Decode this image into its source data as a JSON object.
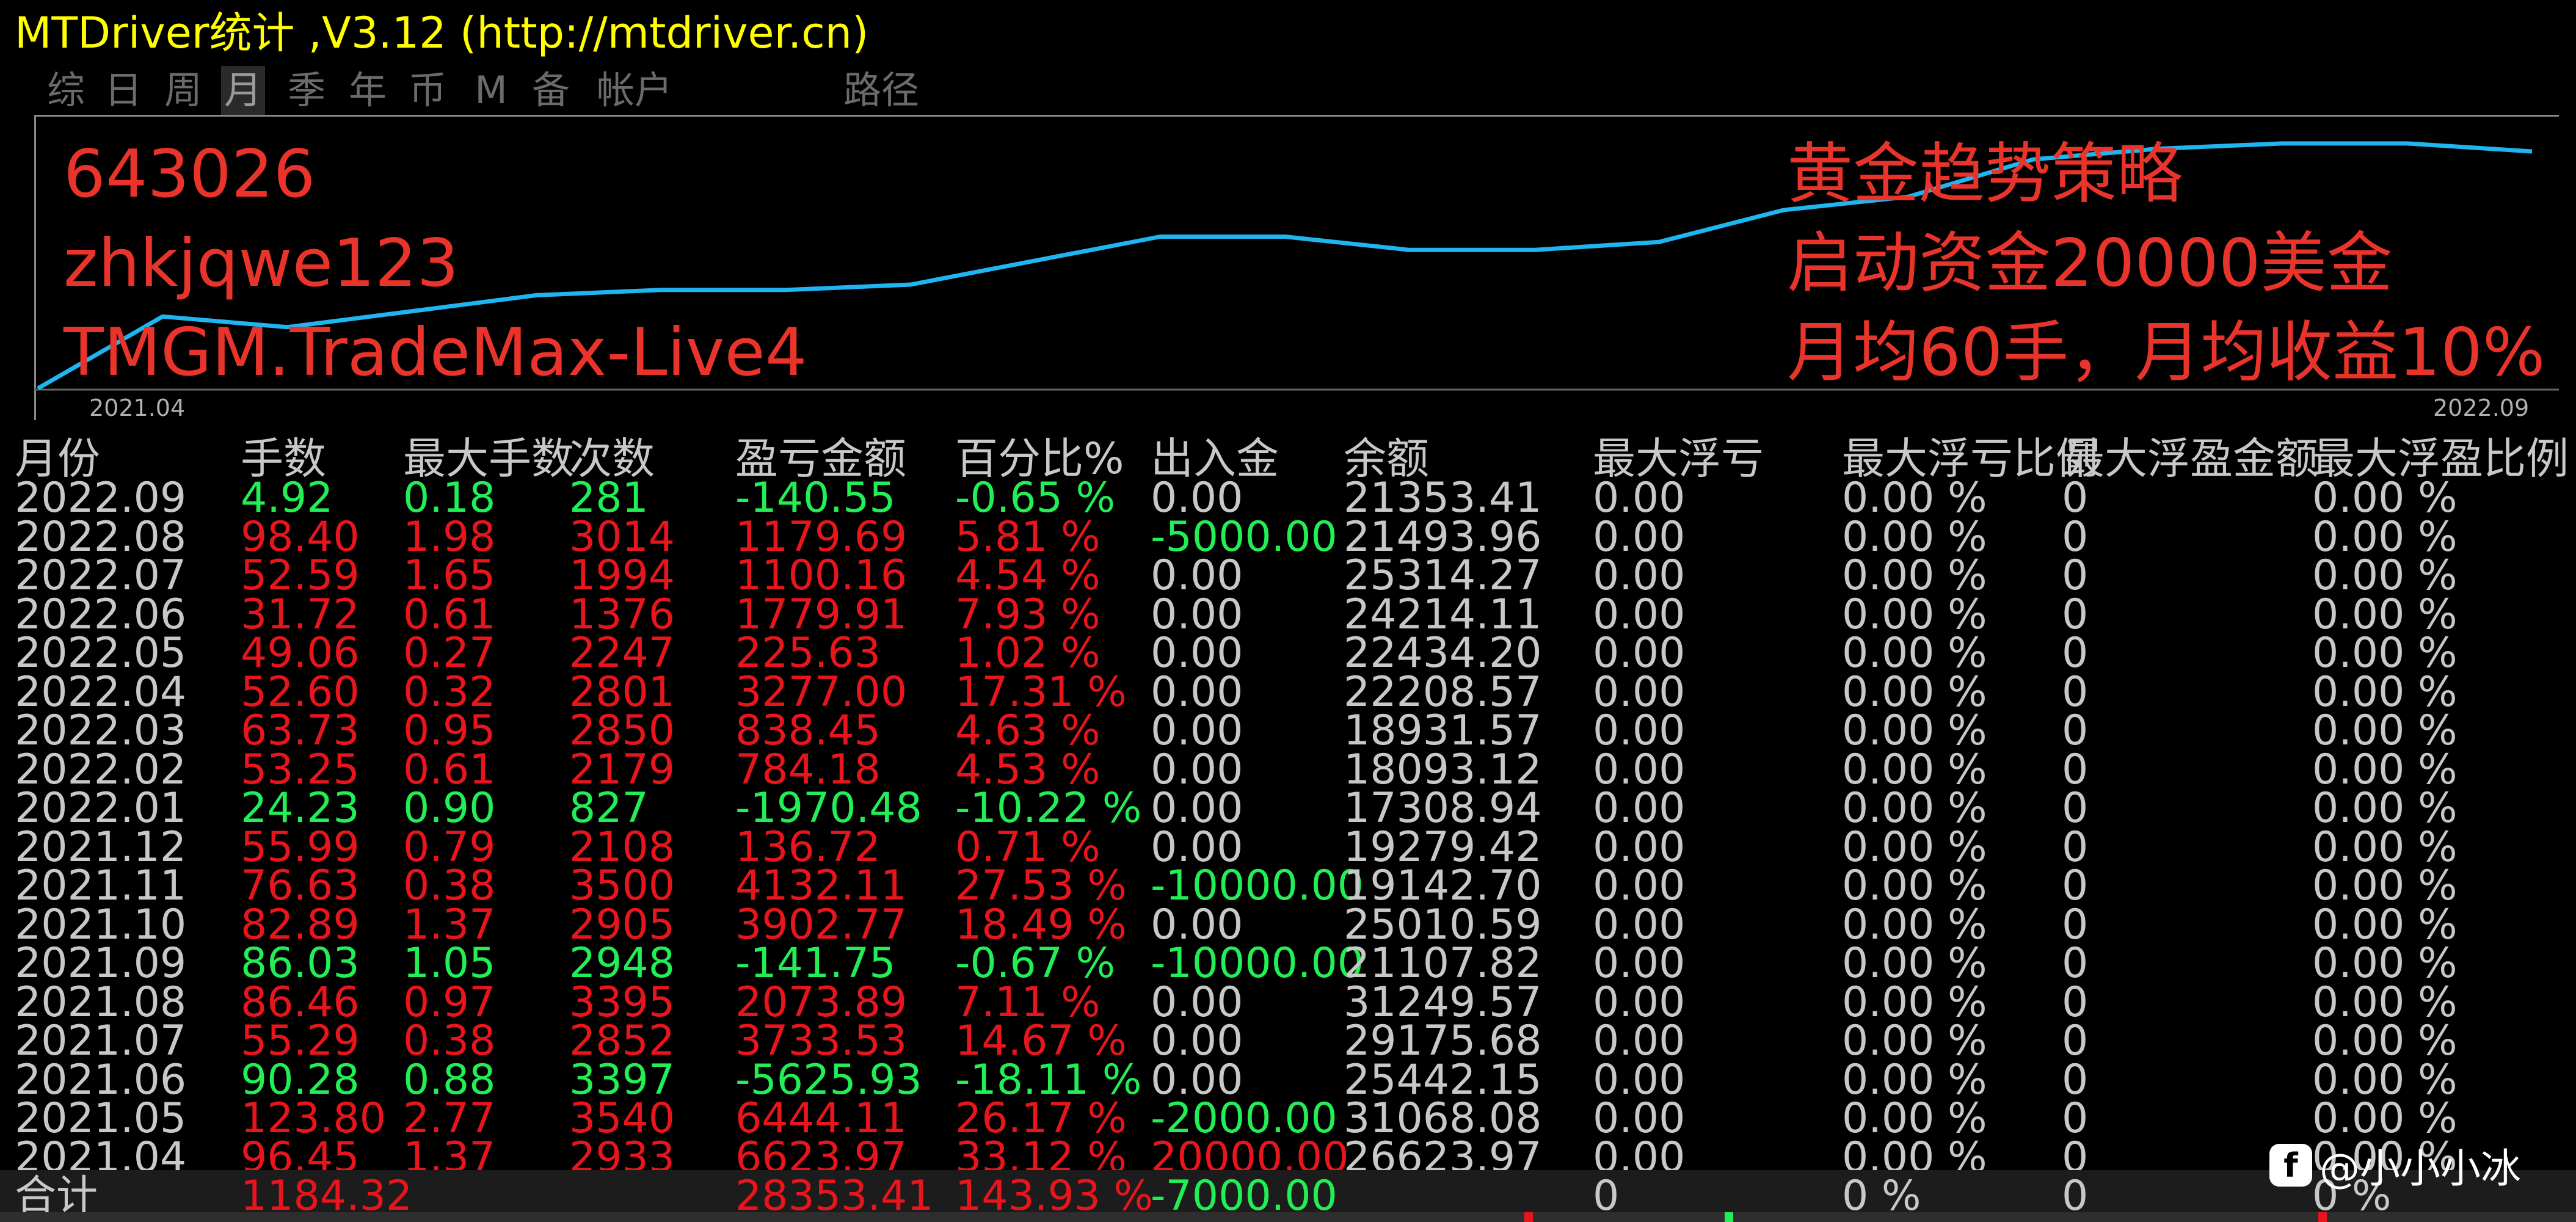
{
  "window": {
    "title": "MTDriver统计 ,V3.12 (http://mtdriver.cn)"
  },
  "tabs": [
    {
      "label": "综",
      "active": false
    },
    {
      "label": "日",
      "active": false
    },
    {
      "label": "周",
      "active": false
    },
    {
      "label": "月",
      "active": true
    },
    {
      "label": "季",
      "active": false
    },
    {
      "label": "年",
      "active": false
    },
    {
      "label": "币",
      "active": false
    },
    {
      "label": "M",
      "active": false
    },
    {
      "label": "备",
      "active": false
    },
    {
      "label": "帐户",
      "active": false
    },
    {
      "label": "路径",
      "active": false
    }
  ],
  "overlay": {
    "left_lines": [
      "643026",
      "zhkjqwe123",
      "TMGM.TradeMax-Live4"
    ],
    "right_lines": [
      "黄金趋势策略",
      "启动资金20000美金",
      "月均60手，月均收益10%"
    ]
  },
  "chart_data": {
    "type": "line",
    "x_start_label": "2021.04",
    "x_end_label": "2022.09",
    "series_color": "#1fb5f0",
    "points": [
      0.0,
      0.27,
      0.23,
      0.29,
      0.35,
      0.37,
      0.37,
      0.39,
      0.48,
      0.57,
      0.57,
      0.52,
      0.52,
      0.55,
      0.67,
      0.72,
      0.86,
      0.9,
      0.92,
      0.92,
      0.89
    ]
  },
  "table": {
    "headers": [
      "月份",
      "手数",
      "最大手数",
      "次数",
      "盈亏金额",
      "百分比%",
      "出入金",
      "余额",
      "最大浮亏",
      "最大浮亏比例",
      "最大浮盈金额",
      "最大浮盈比例"
    ],
    "rows": [
      {
        "month": "2022.09",
        "lots": "4.92",
        "max_lots": "0.18",
        "count": "281",
        "pnl": "-140.55",
        "pct": "-0.65 %",
        "deposit": "0.00",
        "balance": "21353.41",
        "max_float_loss": "0.00",
        "max_float_loss_pct": "0.00 %",
        "max_float_profit": "0",
        "max_float_profit_pct": "0.00 %",
        "color": "green",
        "deposit_color": "gray"
      },
      {
        "month": "2022.08",
        "lots": "98.40",
        "max_lots": "1.98",
        "count": "3014",
        "pnl": "1179.69",
        "pct": "5.81 %",
        "deposit": "-5000.00",
        "balance": "21493.96",
        "max_float_loss": "0.00",
        "max_float_loss_pct": "0.00 %",
        "max_float_profit": "0",
        "max_float_profit_pct": "0.00 %",
        "color": "red",
        "deposit_color": "green"
      },
      {
        "month": "2022.07",
        "lots": "52.59",
        "max_lots": "1.65",
        "count": "1994",
        "pnl": "1100.16",
        "pct": "4.54 %",
        "deposit": "0.00",
        "balance": "25314.27",
        "max_float_loss": "0.00",
        "max_float_loss_pct": "0.00 %",
        "max_float_profit": "0",
        "max_float_profit_pct": "0.00 %",
        "color": "red",
        "deposit_color": "gray"
      },
      {
        "month": "2022.06",
        "lots": "31.72",
        "max_lots": "0.61",
        "count": "1376",
        "pnl": "1779.91",
        "pct": "7.93 %",
        "deposit": "0.00",
        "balance": "24214.11",
        "max_float_loss": "0.00",
        "max_float_loss_pct": "0.00 %",
        "max_float_profit": "0",
        "max_float_profit_pct": "0.00 %",
        "color": "red",
        "deposit_color": "gray"
      },
      {
        "month": "2022.05",
        "lots": "49.06",
        "max_lots": "0.27",
        "count": "2247",
        "pnl": "225.63",
        "pct": "1.02 %",
        "deposit": "0.00",
        "balance": "22434.20",
        "max_float_loss": "0.00",
        "max_float_loss_pct": "0.00 %",
        "max_float_profit": "0",
        "max_float_profit_pct": "0.00 %",
        "color": "red",
        "deposit_color": "gray"
      },
      {
        "month": "2022.04",
        "lots": "52.60",
        "max_lots": "0.32",
        "count": "2801",
        "pnl": "3277.00",
        "pct": "17.31 %",
        "deposit": "0.00",
        "balance": "22208.57",
        "max_float_loss": "0.00",
        "max_float_loss_pct": "0.00 %",
        "max_float_profit": "0",
        "max_float_profit_pct": "0.00 %",
        "color": "red",
        "deposit_color": "gray"
      },
      {
        "month": "2022.03",
        "lots": "63.73",
        "max_lots": "0.95",
        "count": "2850",
        "pnl": "838.45",
        "pct": "4.63 %",
        "deposit": "0.00",
        "balance": "18931.57",
        "max_float_loss": "0.00",
        "max_float_loss_pct": "0.00 %",
        "max_float_profit": "0",
        "max_float_profit_pct": "0.00 %",
        "color": "red",
        "deposit_color": "gray"
      },
      {
        "month": "2022.02",
        "lots": "53.25",
        "max_lots": "0.61",
        "count": "2179",
        "pnl": "784.18",
        "pct": "4.53 %",
        "deposit": "0.00",
        "balance": "18093.12",
        "max_float_loss": "0.00",
        "max_float_loss_pct": "0.00 %",
        "max_float_profit": "0",
        "max_float_profit_pct": "0.00 %",
        "color": "red",
        "deposit_color": "gray"
      },
      {
        "month": "2022.01",
        "lots": "24.23",
        "max_lots": "0.90",
        "count": "827",
        "pnl": "-1970.48",
        "pct": "-10.22 %",
        "deposit": "0.00",
        "balance": "17308.94",
        "max_float_loss": "0.00",
        "max_float_loss_pct": "0.00 %",
        "max_float_profit": "0",
        "max_float_profit_pct": "0.00 %",
        "color": "green",
        "deposit_color": "gray"
      },
      {
        "month": "2021.12",
        "lots": "55.99",
        "max_lots": "0.79",
        "count": "2108",
        "pnl": "136.72",
        "pct": "0.71 %",
        "deposit": "0.00",
        "balance": "19279.42",
        "max_float_loss": "0.00",
        "max_float_loss_pct": "0.00 %",
        "max_float_profit": "0",
        "max_float_profit_pct": "0.00 %",
        "color": "red",
        "deposit_color": "gray"
      },
      {
        "month": "2021.11",
        "lots": "76.63",
        "max_lots": "0.38",
        "count": "3500",
        "pnl": "4132.11",
        "pct": "27.53 %",
        "deposit": "-10000.00",
        "balance": "19142.70",
        "max_float_loss": "0.00",
        "max_float_loss_pct": "0.00 %",
        "max_float_profit": "0",
        "max_float_profit_pct": "0.00 %",
        "color": "red",
        "deposit_color": "green"
      },
      {
        "month": "2021.10",
        "lots": "82.89",
        "max_lots": "1.37",
        "count": "2905",
        "pnl": "3902.77",
        "pct": "18.49 %",
        "deposit": "0.00",
        "balance": "25010.59",
        "max_float_loss": "0.00",
        "max_float_loss_pct": "0.00 %",
        "max_float_profit": "0",
        "max_float_profit_pct": "0.00 %",
        "color": "red",
        "deposit_color": "gray"
      },
      {
        "month": "2021.09",
        "lots": "86.03",
        "max_lots": "1.05",
        "count": "2948",
        "pnl": "-141.75",
        "pct": "-0.67 %",
        "deposit": "-10000.00",
        "balance": "21107.82",
        "max_float_loss": "0.00",
        "max_float_loss_pct": "0.00 %",
        "max_float_profit": "0",
        "max_float_profit_pct": "0.00 %",
        "color": "green",
        "deposit_color": "green"
      },
      {
        "month": "2021.08",
        "lots": "86.46",
        "max_lots": "0.97",
        "count": "3395",
        "pnl": "2073.89",
        "pct": "7.11 %",
        "deposit": "0.00",
        "balance": "31249.57",
        "max_float_loss": "0.00",
        "max_float_loss_pct": "0.00 %",
        "max_float_profit": "0",
        "max_float_profit_pct": "0.00 %",
        "color": "red",
        "deposit_color": "gray"
      },
      {
        "month": "2021.07",
        "lots": "55.29",
        "max_lots": "0.38",
        "count": "2852",
        "pnl": "3733.53",
        "pct": "14.67 %",
        "deposit": "0.00",
        "balance": "29175.68",
        "max_float_loss": "0.00",
        "max_float_loss_pct": "0.00 %",
        "max_float_profit": "0",
        "max_float_profit_pct": "0.00 %",
        "color": "red",
        "deposit_color": "gray"
      },
      {
        "month": "2021.06",
        "lots": "90.28",
        "max_lots": "0.88",
        "count": "3397",
        "pnl": "-5625.93",
        "pct": "-18.11 %",
        "deposit": "0.00",
        "balance": "25442.15",
        "max_float_loss": "0.00",
        "max_float_loss_pct": "0.00 %",
        "max_float_profit": "0",
        "max_float_profit_pct": "0.00 %",
        "color": "green",
        "deposit_color": "gray"
      },
      {
        "month": "2021.05",
        "lots": "123.80",
        "max_lots": "2.77",
        "count": "3540",
        "pnl": "6444.11",
        "pct": "26.17 %",
        "deposit": "-2000.00",
        "balance": "31068.08",
        "max_float_loss": "0.00",
        "max_float_loss_pct": "0.00 %",
        "max_float_profit": "0",
        "max_float_profit_pct": "0.00 %",
        "color": "red",
        "deposit_color": "green"
      },
      {
        "month": "2021.04",
        "lots": "96.45",
        "max_lots": "1.37",
        "count": "2933",
        "pnl": "6623.97",
        "pct": "33.12 %",
        "deposit": "20000.00",
        "balance": "26623.97",
        "max_float_loss": "0.00",
        "max_float_loss_pct": "0.00 %",
        "max_float_profit": "0",
        "max_float_profit_pct": "0.00 %",
        "color": "red",
        "deposit_color": "red"
      }
    ],
    "total": {
      "label": "合计",
      "lots": "1184.32",
      "pnl": "28353.41",
      "pct": "143.93 %",
      "deposit": "-7000.00",
      "max_float_loss": "0",
      "max_float_loss_pct": "0 %",
      "max_float_profit": "0",
      "max_float_profit_pct": "0 %"
    }
  },
  "colors": {
    "red": "#e8151c",
    "green": "#22ee55",
    "gray": "#c8c8c8",
    "title": "#ffff00",
    "line": "#1fb5f0",
    "overlay": "#e8342a"
  },
  "watermark": {
    "logo": "f",
    "text": "@小小小冰"
  }
}
